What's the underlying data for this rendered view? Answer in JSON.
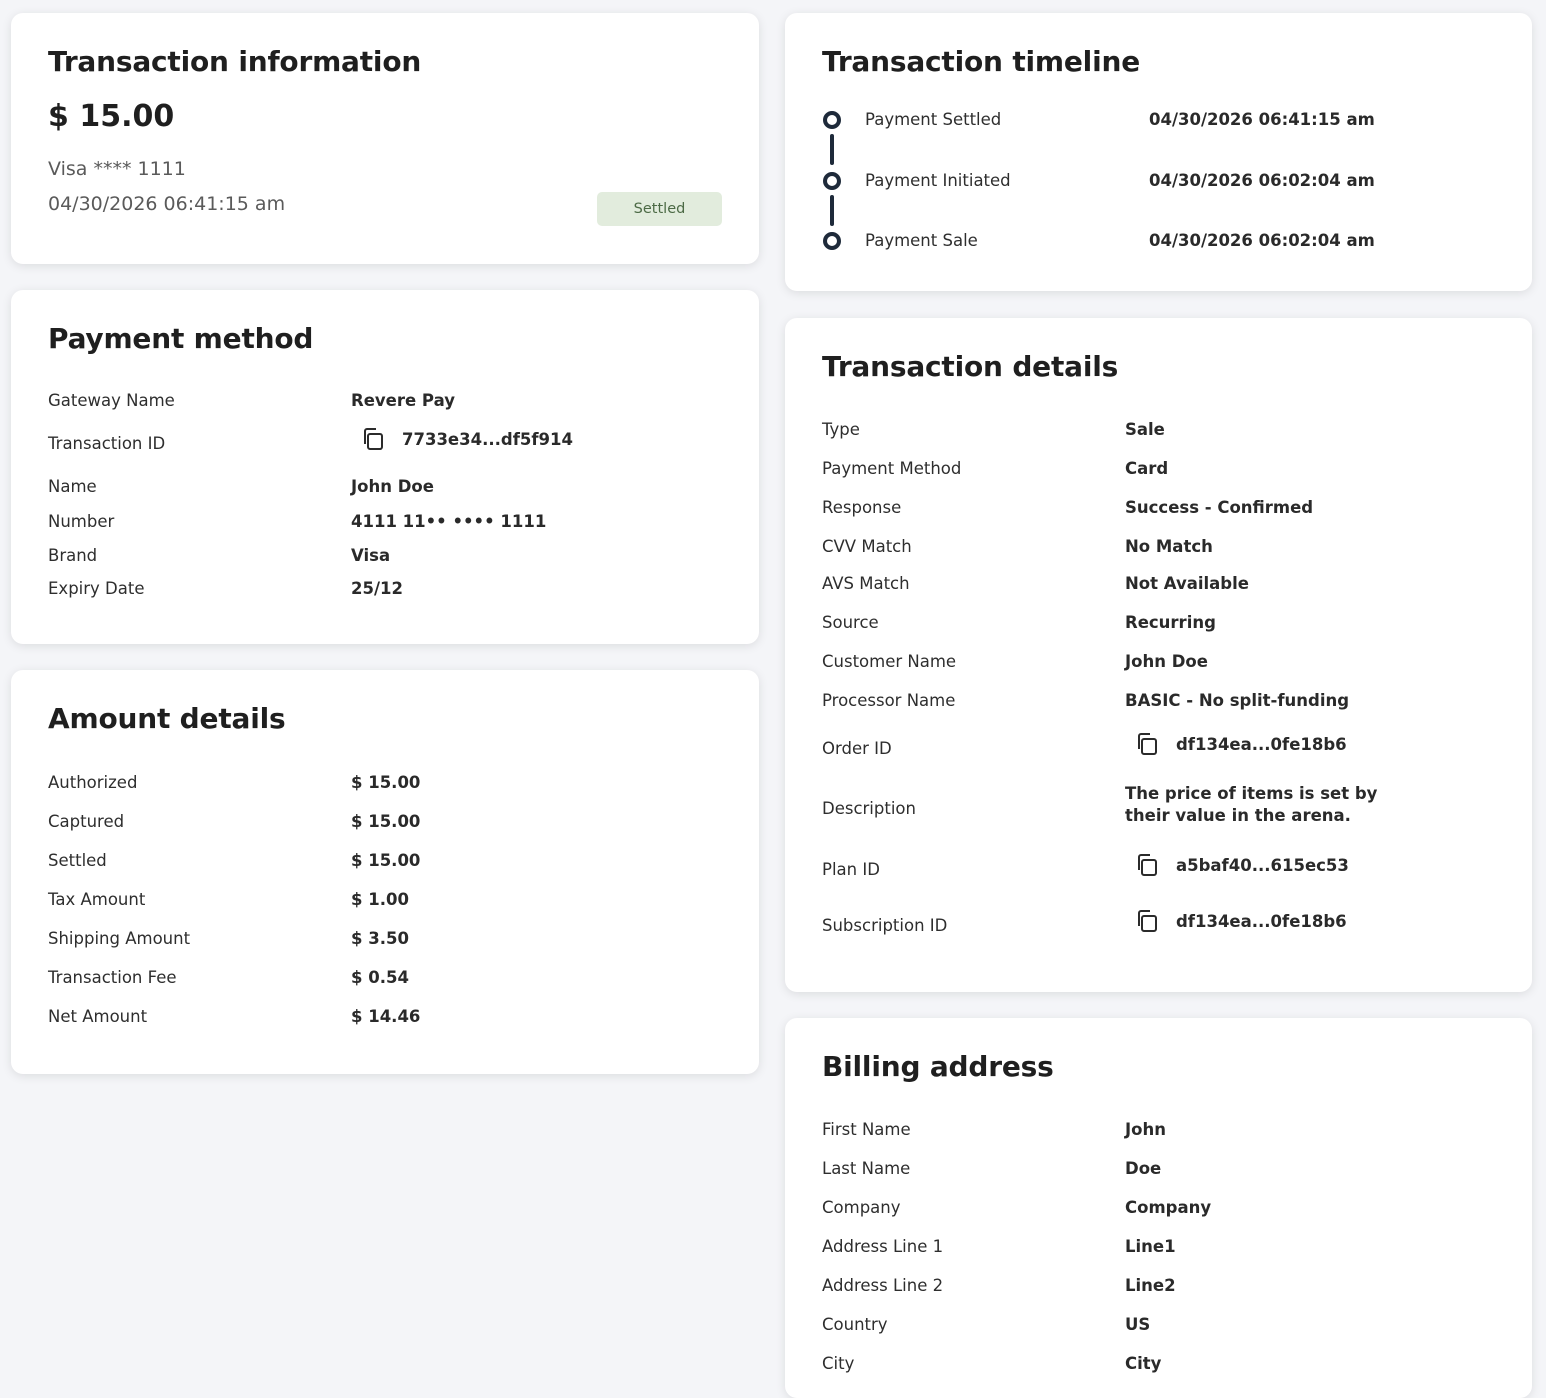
{
  "transaction_info": {
    "title": "Transaction information",
    "amount": "$ 15.00",
    "card": "Visa **** 1111",
    "datetime": "04/30/2026 06:41:15 am",
    "status": "Settled"
  },
  "payment_method": {
    "title": "Payment method",
    "rows": [
      {
        "label": "Gateway Name",
        "value": "Revere Pay"
      },
      {
        "label": "Transaction ID",
        "value": "7733e34...df5f914"
      },
      {
        "label": "Name",
        "value": "John Doe"
      },
      {
        "label": "Number",
        "value": "4111 11•• •••• 1111"
      },
      {
        "label": "Brand",
        "value": "Visa"
      },
      {
        "label": "Expiry Date",
        "value": "25/12"
      }
    ]
  },
  "amount_details": {
    "title": "Amount details",
    "rows": [
      {
        "label": "Authorized",
        "value": "$ 15.00"
      },
      {
        "label": "Captured",
        "value": "$ 15.00"
      },
      {
        "label": "Settled",
        "value": "$ 15.00"
      },
      {
        "label": "Tax Amount",
        "value": "$ 1.00"
      },
      {
        "label": "Shipping Amount",
        "value": "$ 3.50"
      },
      {
        "label": "Transaction Fee",
        "value": "$ 0.54"
      },
      {
        "label": "Net Amount",
        "value": "$ 14.46"
      }
    ]
  },
  "timeline": {
    "title": "Transaction timeline",
    "items": [
      {
        "label": "Payment Settled",
        "time": "04/30/2026 06:41:15 am"
      },
      {
        "label": "Payment Initiated",
        "time": "04/30/2026 06:02:04 am"
      },
      {
        "label": "Payment Sale",
        "time": "04/30/2026 06:02:04 am"
      }
    ]
  },
  "transaction_details": {
    "title": "Transaction details",
    "rows": [
      {
        "label": "Type",
        "value": "Sale"
      },
      {
        "label": "Payment Method",
        "value": "Card"
      },
      {
        "label": "Response",
        "value": "Success - Confirmed"
      },
      {
        "label": "CVV Match",
        "value": "No Match"
      },
      {
        "label": "AVS Match",
        "value": "Not Available"
      },
      {
        "label": "Source",
        "value": "Recurring"
      },
      {
        "label": "Customer Name",
        "value": "John Doe"
      },
      {
        "label": "Processor Name",
        "value": "BASIC - No split-funding"
      },
      {
        "label": "Order ID",
        "value": "df134ea...0fe18b6"
      },
      {
        "label": "Description",
        "value": "The price of items is set by their value in the arena."
      },
      {
        "label": "Plan ID",
        "value": "a5baf40...615ec53"
      },
      {
        "label": "Subscription ID",
        "value": "df134ea...0fe18b6"
      }
    ]
  },
  "billing_address": {
    "title": "Billing address",
    "rows": [
      {
        "label": "First Name",
        "value": "John"
      },
      {
        "label": "Last Name",
        "value": "Doe"
      },
      {
        "label": "Company",
        "value": "Company"
      },
      {
        "label": "Address Line 1",
        "value": "Line1"
      },
      {
        "label": "Address Line 2",
        "value": "Line2"
      },
      {
        "label": "Country",
        "value": "US"
      },
      {
        "label": "City",
        "value": "City"
      }
    ]
  }
}
